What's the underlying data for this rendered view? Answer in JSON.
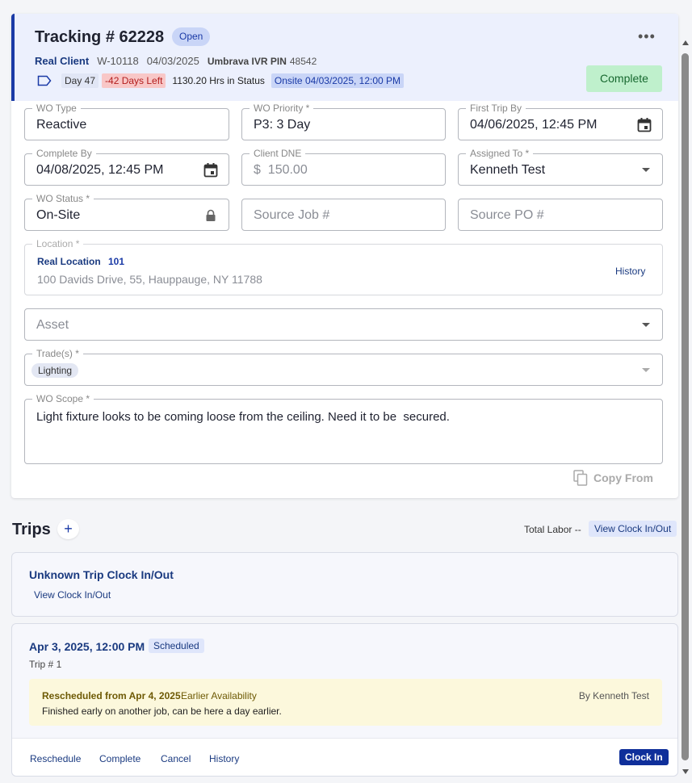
{
  "header": {
    "title": "Tracking # 62228",
    "status_badge": "Open",
    "more_label": "•••",
    "client": "Real Client",
    "wo_number": "W-10118",
    "date": "04/03/2025",
    "pin_label": "Umbrava IVR PIN",
    "pin_value": "48542",
    "day": "Day 47",
    "days_left": "-42 Days Left",
    "hrs_in_status": "1130.20 Hrs in Status",
    "onsite": "Onsite 04/03/2025, 12:00 PM",
    "complete_label": "Complete"
  },
  "fields": {
    "wo_type": {
      "label": "WO Type",
      "value": "Reactive"
    },
    "wo_priority": {
      "label": "WO Priority *",
      "value": "P3: 3 Day"
    },
    "first_trip_by": {
      "label": "First Trip By",
      "value": "04/06/2025, 12:45 PM"
    },
    "complete_by": {
      "label": "Complete By",
      "value": "04/08/2025, 12:45 PM"
    },
    "client_dne": {
      "label": "Client DNE",
      "value": "$  150.00"
    },
    "assigned_to": {
      "label": "Assigned To *",
      "value": "Kenneth Test"
    },
    "wo_status": {
      "label": "WO Status *",
      "value": "On-Site"
    },
    "source_job": {
      "placeholder": "Source Job #"
    },
    "source_po": {
      "placeholder": "Source PO #"
    },
    "location": {
      "label": "Location *",
      "name": "Real Location",
      "code": "101",
      "address": "100 Davids Drive, 55, Hauppauge, NY 11788",
      "history_label": "History"
    },
    "asset": {
      "placeholder": "Asset"
    },
    "trades": {
      "label": "Trade(s) *",
      "chips": [
        "Lighting"
      ]
    },
    "wo_scope": {
      "label": "WO Scope *",
      "value": "Light fixture looks to be coming loose from the ceiling. Need it to be  secured."
    },
    "copy_from_label": "Copy From"
  },
  "trips": {
    "title": "Trips",
    "add_label": "+",
    "total_labor": "Total Labor --",
    "view_clock_label": "View Clock In/Out",
    "unknown": {
      "title": "Unknown Trip Clock In/Out",
      "link": "View Clock In/Out"
    },
    "items": [
      {
        "date": "Apr 3, 2025, 12:00 PM",
        "status": "Scheduled",
        "trip_number": "Trip # 1",
        "note": {
          "from": "Rescheduled from Apr 4, 2025",
          "reason": "Earlier Availability",
          "by": "By Kenneth Test",
          "text": "Finished early on another job, can be here a day earlier."
        },
        "actions": [
          "Reschedule",
          "Complete",
          "Cancel",
          "History"
        ],
        "clock_in_label": "Clock In"
      }
    ]
  },
  "colors": {
    "accent": "#1a3aa6",
    "header_bg": "#ecf0fd",
    "complete_bg": "#bff0cc",
    "days_left_bg": "#f8c7c7",
    "note_bg": "#fcf8dc"
  }
}
